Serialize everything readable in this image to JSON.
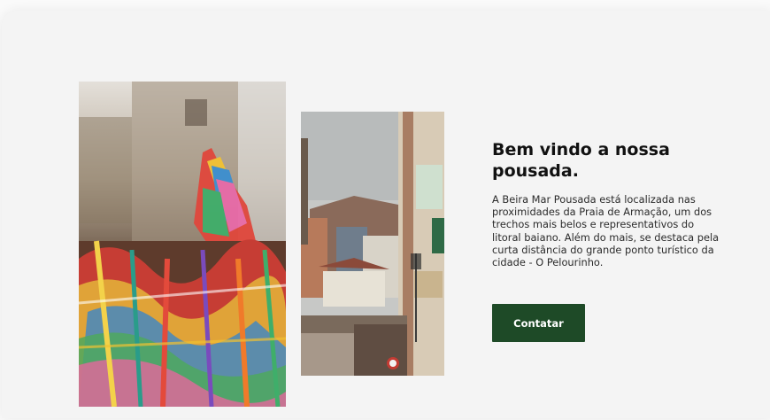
{
  "welcome": {
    "title": "Bem vindo a nossa pousada.",
    "description": "A Beira Mar Pousada está localizada nas proximidades da Praia de Armação, um dos trechos mais  belos e representativos do litoral baiano. Além do mais, se destaca pela curta  distância do grande ponto turístico da cidade - O Pelourinho.",
    "cta_label": "Contatar"
  },
  "colors": {
    "cta_background": "#1e4a27",
    "cta_text": "#ffffff",
    "card_background": "#f4f4f4"
  },
  "images": {
    "left": "colorful-festival-ribbons-photo",
    "middle": "pelourinho-street-photo"
  }
}
